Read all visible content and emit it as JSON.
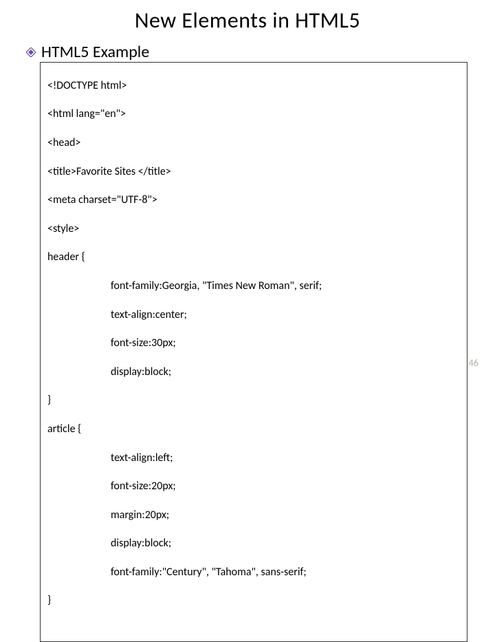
{
  "title": "New Elements in HTML5",
  "subtitle": "HTML5 Example",
  "code": {
    "l1": "<!DOCTYPE html>",
    "l2": "<html lang=\"en\">",
    "l3": "<head>",
    "l4": "<title>Favorite Sites </title>",
    "l5": "<meta charset=\"UTF-8\">",
    "l6": "<style>",
    "l7": "header {",
    "l8": "font-family:Georgia, \"Times New Roman\", serif;",
    "l9": "text-align:center;",
    "l10": "font-size:30px;",
    "l11": "display:block;",
    "l12": "}",
    "l13": "article {",
    "l14": "text-align:left;",
    "l15": "font-size:20px;",
    "l16": "margin:20px;",
    "l17": "display:block;",
    "l18": "font-family:\"Century\", \"Tahoma\", sans-serif;",
    "l19": "}"
  },
  "pageNumber": "46"
}
